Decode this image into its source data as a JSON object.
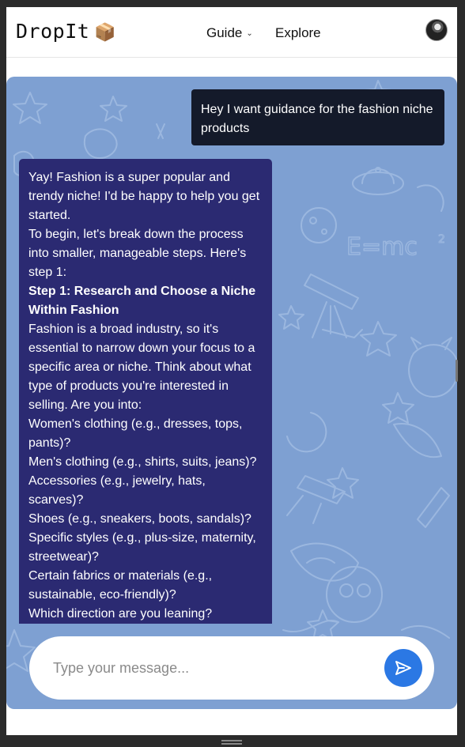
{
  "app": {
    "brand": "DropIt",
    "brand_icon": "📦"
  },
  "nav": {
    "guide_label": "Guide",
    "explore_label": "Explore"
  },
  "chat": {
    "user_message": "Hey I want guidance for the fashion niche products",
    "bot_paragraphs": [
      "Yay! Fashion is a super popular and trendy niche! I'd be happy to help you get started.",
      "To begin, let's break down the process into smaller, manageable steps. Here's step 1:",
      "Step 1: Research and Choose a Niche Within Fashion",
      "Fashion is a broad industry, so it's essential to narrow down your focus to a specific area or niche. Think about what type of products you're interested in selling. Are you into:",
      "Women's clothing (e.g., dresses, tops, pants)?",
      "Men's clothing (e.g., shirts, suits, jeans)?",
      "Accessories (e.g., jewelry, hats, scarves)?",
      "Shoes (e.g., sneakers, boots, sandals)?",
      "Specific styles (e.g., plus-size, maternity, streetwear)?",
      "Certain fabrics or materials (e.g., sustainable, eco-friendly)?",
      "Which direction are you leaning?"
    ]
  },
  "composer": {
    "placeholder": "Type your message..."
  },
  "colors": {
    "chat_background": "#7ea0d2",
    "user_bubble": "#141a2a",
    "bot_bubble": "#2b2a72",
    "send_button": "#2b78e4"
  },
  "icons": {
    "brand": "package-icon",
    "guide_dropdown": "chevron-down-icon",
    "send": "send-icon",
    "avatar": "user-avatar"
  }
}
